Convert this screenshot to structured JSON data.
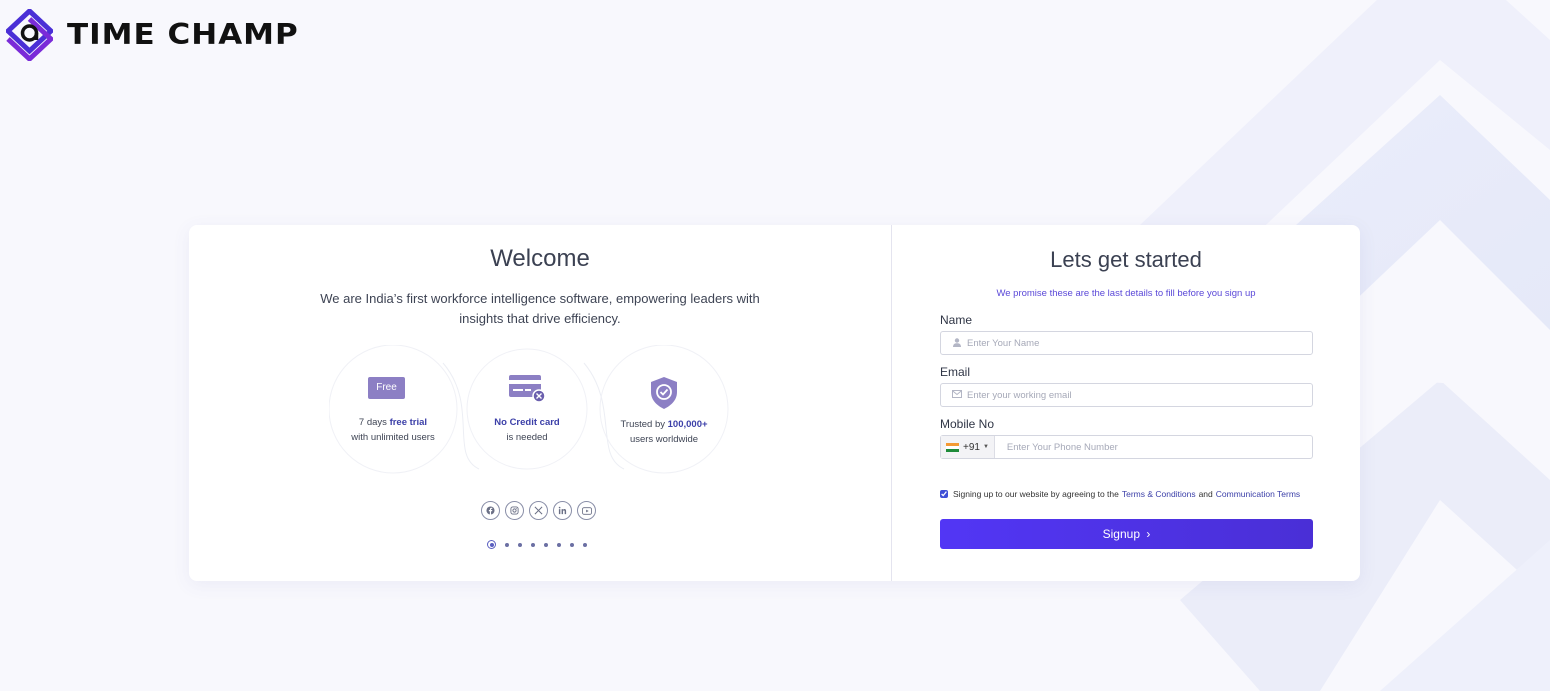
{
  "brand": {
    "name": "TIME CHAMP",
    "logo_icon": "time-champ-logo-icon",
    "accent": "#5236f5"
  },
  "welcome": {
    "title": "Welcome",
    "tagline": "We are India’s first workforce intelligence software, empowering leaders with insights that drive efficiency.",
    "features": [
      {
        "badge": "Free",
        "line1_prefix": "7 days ",
        "line1_bold": "free trial",
        "line2": "with unlimited users"
      },
      {
        "icon": "credit-card-icon",
        "line1_bold": "No Credit card",
        "line2": "is needed"
      },
      {
        "icon": "shield-check-icon",
        "line1_prefix": "Trusted by ",
        "line1_bold": "100,000+",
        "line2": "users worldwide"
      }
    ],
    "socials": [
      "facebook-icon",
      "instagram-icon",
      "x-icon",
      "linkedin-icon",
      "youtube-icon"
    ],
    "carousel": {
      "total": 8,
      "active": 1
    }
  },
  "signup": {
    "title": "Lets get started",
    "subtitle": "We promise these are the last details to fill before you sign up",
    "name_label": "Name",
    "name_placeholder": "Enter Your Name",
    "email_label": "Email",
    "email_placeholder": "Enter your working email",
    "mobile_label": "Mobile No",
    "country_code": "+91",
    "phone_placeholder": "Enter Your Phone Number",
    "terms_prefix": "Signing up to our website by agreeing to the",
    "terms_link": "Terms & Conditions",
    "terms_and": "and",
    "comm_link": "Communication Terms",
    "terms_checked": true,
    "button_label": "Signup",
    "button_arrow": "›"
  }
}
